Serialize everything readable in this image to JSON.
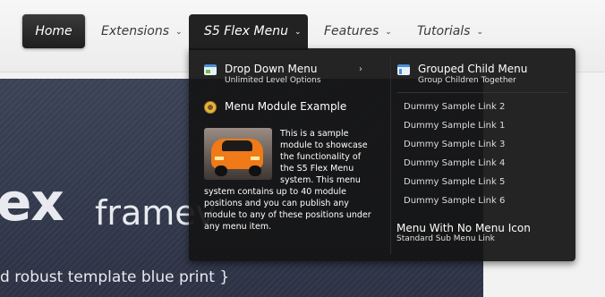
{
  "nav": {
    "items": [
      {
        "label": "Home"
      },
      {
        "label": "Extensions"
      },
      {
        "label": "S5 Flex Menu"
      },
      {
        "label": "Features"
      },
      {
        "label": "Tutorials"
      }
    ],
    "chevron": "⌄"
  },
  "dropdown": {
    "left": {
      "drop_title": "Drop Down Menu",
      "drop_sub": "Unlimited Level Options",
      "arrow": "›",
      "module_title": "Menu Module Example",
      "module_text_a": "This is a sample module to showcase the functionality of the S5 Flex Menu system. This menu",
      "module_text_b": "system contains up to 40 module positions and you can publish any module to any of these positions under any menu item."
    },
    "right": {
      "grouped_title": "Grouped Child Menu",
      "grouped_sub": "Group Children Together",
      "links": [
        "Dummy Sample Link 2",
        "Dummy Sample Link 1",
        "Dummy Sample Link 3",
        "Dummy Sample Link 4",
        "Dummy Sample Link 5",
        "Dummy Sample Link 6"
      ],
      "noicon_title": "Menu With No Menu Icon",
      "noicon_sub": "Standard Sub Menu Link"
    }
  },
  "hero": {
    "big_text": "ex",
    "word": "framev",
    "tagline": "d robust  template blue print }"
  },
  "icons": {
    "dropdown": "window-icon",
    "module": "gear-icon",
    "grouped": "layout-icon"
  },
  "colors": {
    "dropdown_bg": "#141414",
    "nav_active": "#222222",
    "hero_bg": "#343a4d"
  }
}
